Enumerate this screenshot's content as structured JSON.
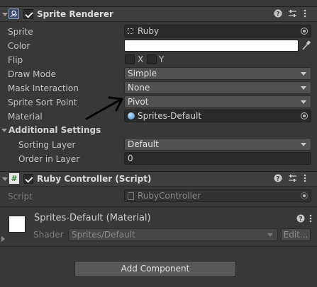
{
  "sprite_renderer": {
    "title": "Sprite Renderer",
    "enabled": true,
    "fields": {
      "sprite": {
        "label": "Sprite",
        "value": "Ruby"
      },
      "color": {
        "label": "Color",
        "value": "#ffffff"
      },
      "flip": {
        "label": "Flip",
        "x_label": "X",
        "y_label": "Y"
      },
      "draw_mode": {
        "label": "Draw Mode",
        "value": "Simple"
      },
      "mask_interaction": {
        "label": "Mask Interaction",
        "value": "None"
      },
      "sprite_sort_point": {
        "label": "Sprite Sort Point",
        "value": "Pivot"
      },
      "material": {
        "label": "Material",
        "value": "Sprites-Default"
      }
    },
    "additional_settings": {
      "title": "Additional Settings",
      "sorting_layer": {
        "label": "Sorting Layer",
        "value": "Default"
      },
      "order_in_layer": {
        "label": "Order in Layer",
        "value": "0"
      }
    }
  },
  "ruby_controller": {
    "title": "Ruby Controller (Script)",
    "enabled": true,
    "script": {
      "label": "Script",
      "value": "RubyController"
    }
  },
  "material_section": {
    "title": "Sprites-Default (Material)",
    "shader_label": "Shader",
    "shader_value": "Sprites/Default",
    "edit_label": "Edit..."
  },
  "add_component_label": "Add Component",
  "colors": {
    "background": "#383838",
    "header": "#3e3e3e",
    "field": "#2a2a2a",
    "dropdown": "#515151",
    "annotation_arrow": "#000000"
  },
  "icons": {
    "sprite_renderer": "sprite-renderer-component-icon",
    "script": "csharp-script-icon",
    "help": "help-icon",
    "presets": "presets-sliders-icon",
    "menu": "kebab-menu-icon",
    "eyedropper": "eyedropper-icon",
    "object_picker": "object-picker-icon"
  }
}
